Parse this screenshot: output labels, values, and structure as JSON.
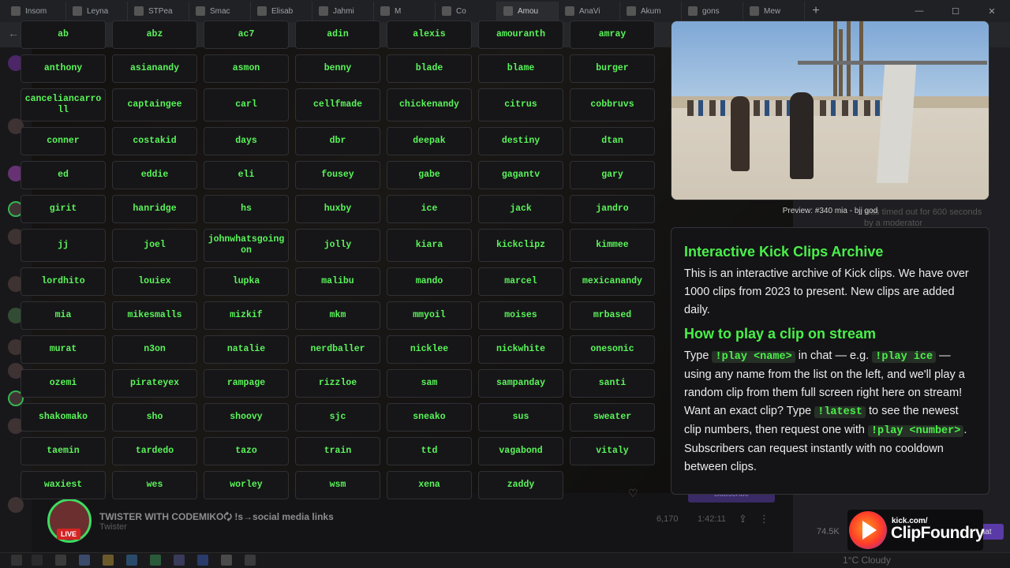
{
  "browser": {
    "tabs": [
      "Insom",
      "Leyna",
      "STPea",
      "Smac",
      "Elisab",
      "Jahmi",
      "M",
      "Co",
      "Amou",
      "AnaVi",
      "Akum",
      "gons",
      "Mew"
    ],
    "active_tab_index": 8,
    "new_tab_glyph": "+",
    "win_min": "—",
    "win_max": "☐",
    "win_close": "✕",
    "back_glyph": "←"
  },
  "clip_overlay": {
    "names": [
      "ab",
      "abz",
      "ac7",
      "adin",
      "alexis",
      "amouranth",
      "amray",
      "anthony",
      "asianandy",
      "asmon",
      "benny",
      "blade",
      "blame",
      "burger",
      "canceliancarroll",
      "captaingee",
      "carl",
      "cellfmade",
      "chickenandy",
      "citrus",
      "cobbruvs",
      "conner",
      "costakid",
      "days",
      "dbr",
      "deepak",
      "destiny",
      "dtan",
      "ed",
      "eddie",
      "eli",
      "fousey",
      "gabe",
      "gagantv",
      "gary",
      "girit",
      "hanridge",
      "hs",
      "huxby",
      "ice",
      "jack",
      "jandro",
      "jj",
      "joel",
      "johnwhatsgoingon",
      "jolly",
      "kiara",
      "kickclipz",
      "kimmee",
      "lordhito",
      "louiex",
      "lupka",
      "malibu",
      "mando",
      "marcel",
      "mexicanandy",
      "mia",
      "mikesmalls",
      "mizkif",
      "mkm",
      "mmyoil",
      "moises",
      "mrbased",
      "murat",
      "n3on",
      "natalie",
      "nerdballer",
      "nicklee",
      "nickwhite",
      "onesonic",
      "ozemi",
      "pirateyex",
      "rampage",
      "rizzloe",
      "sam",
      "sampanday",
      "santi",
      "shakomako",
      "sho",
      "shoovy",
      "sjc",
      "sneako",
      "sus",
      "sweater",
      "taemin",
      "tardedo",
      "tazo",
      "train",
      "ttd",
      "vagabond",
      "vitaly",
      "waxiest",
      "wes",
      "worley",
      "wsm",
      "xena",
      "zaddy"
    ],
    "accent_color": "#4af04a"
  },
  "preview": {
    "caption": "Preview: #340 mia - bjj god"
  },
  "info": {
    "title": "Interactive Kick Clips Archive",
    "intro": "This is an interactive archive of Kick clips. We have over 1000 clips from 2023 to present. New clips are added daily.",
    "howto_title": "How to play a clip on stream",
    "p1": "Type ",
    "cmd_play_name": "!play <name>",
    "p2": " in chat — e.g. ",
    "cmd_play_ice": "!play ice",
    "p3": " — using any name from the list on the left, and we'll play a random clip from them full screen right here on stream! Want an exact clip? Type ",
    "cmd_latest": "!latest",
    "p4": " to see the newest clip numbers, then request one with ",
    "cmd_play_number": "!play <number>",
    "p5": ". Subscribers can request instantly with no cooldown between clips."
  },
  "stream_page": {
    "channel_title": "TWISTER WITH CODEMIKO🗘 !s→social media links",
    "channel_name": "Twister",
    "live_label": "LIVE",
    "viewers": "6,170",
    "uptime": "1:42:11",
    "chat_line": "was timed out for 600 seconds by a moderator",
    "chat_viewers": "74.5K",
    "chat_button": "Chat",
    "subscribe": "Subscribe"
  },
  "logo": {
    "kick_text": "kick.com/",
    "brand": "ClipFoundry"
  },
  "taskbar": {
    "weather": "1°C  Cloudy"
  }
}
